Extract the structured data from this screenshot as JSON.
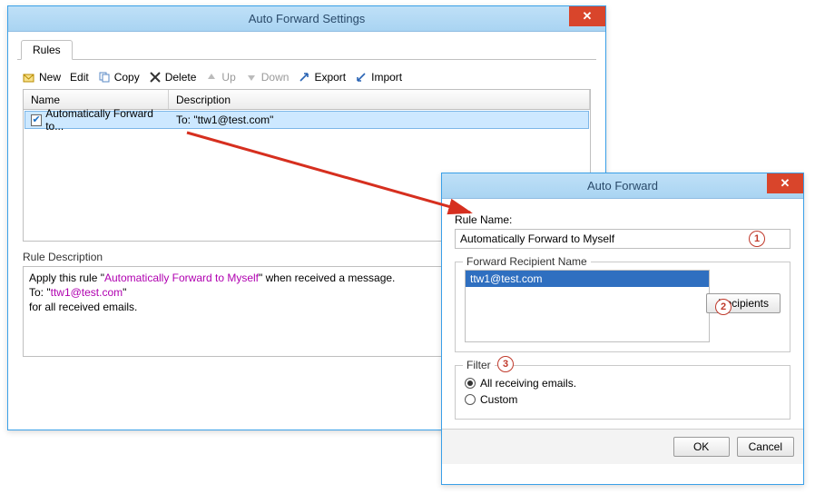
{
  "settings_window": {
    "title": "Auto Forward Settings",
    "tab_label": "Rules",
    "toolbar": {
      "new": "New",
      "edit": "Edit",
      "copy": "Copy",
      "delete": "Delete",
      "up": "Up",
      "down": "Down",
      "export": "Export",
      "import": "Import"
    },
    "grid": {
      "col_name": "Name",
      "col_desc": "Description",
      "row_name": "Automatically Forward to...",
      "row_desc": "To: \"ttw1@test.com\""
    },
    "rule_desc_label": "Rule Description",
    "rule_desc": {
      "line1_pre": "Apply this rule \"",
      "line1_link": "Automatically Forward to Myself",
      "line1_post": "\" when received a message.",
      "line2_pre": "To: \"",
      "line2_link": "ttw1@test.com",
      "line2_post": "\"",
      "line3": "for all received emails."
    }
  },
  "forward_window": {
    "title": "Auto Forward",
    "rule_name_label": "Rule Name:",
    "rule_name_value": "Automatically Forward to Myself",
    "recipient_legend": "Forward Recipient Name",
    "recipient_value": "ttw1@test.com",
    "recipients_btn": "Recipients",
    "filter_legend": "Filter",
    "filter_all": "All receiving emails.",
    "filter_custom": "Custom",
    "ok": "OK",
    "cancel": "Cancel"
  },
  "callouts": {
    "c1": "1",
    "c2": "2",
    "c3": "3"
  }
}
